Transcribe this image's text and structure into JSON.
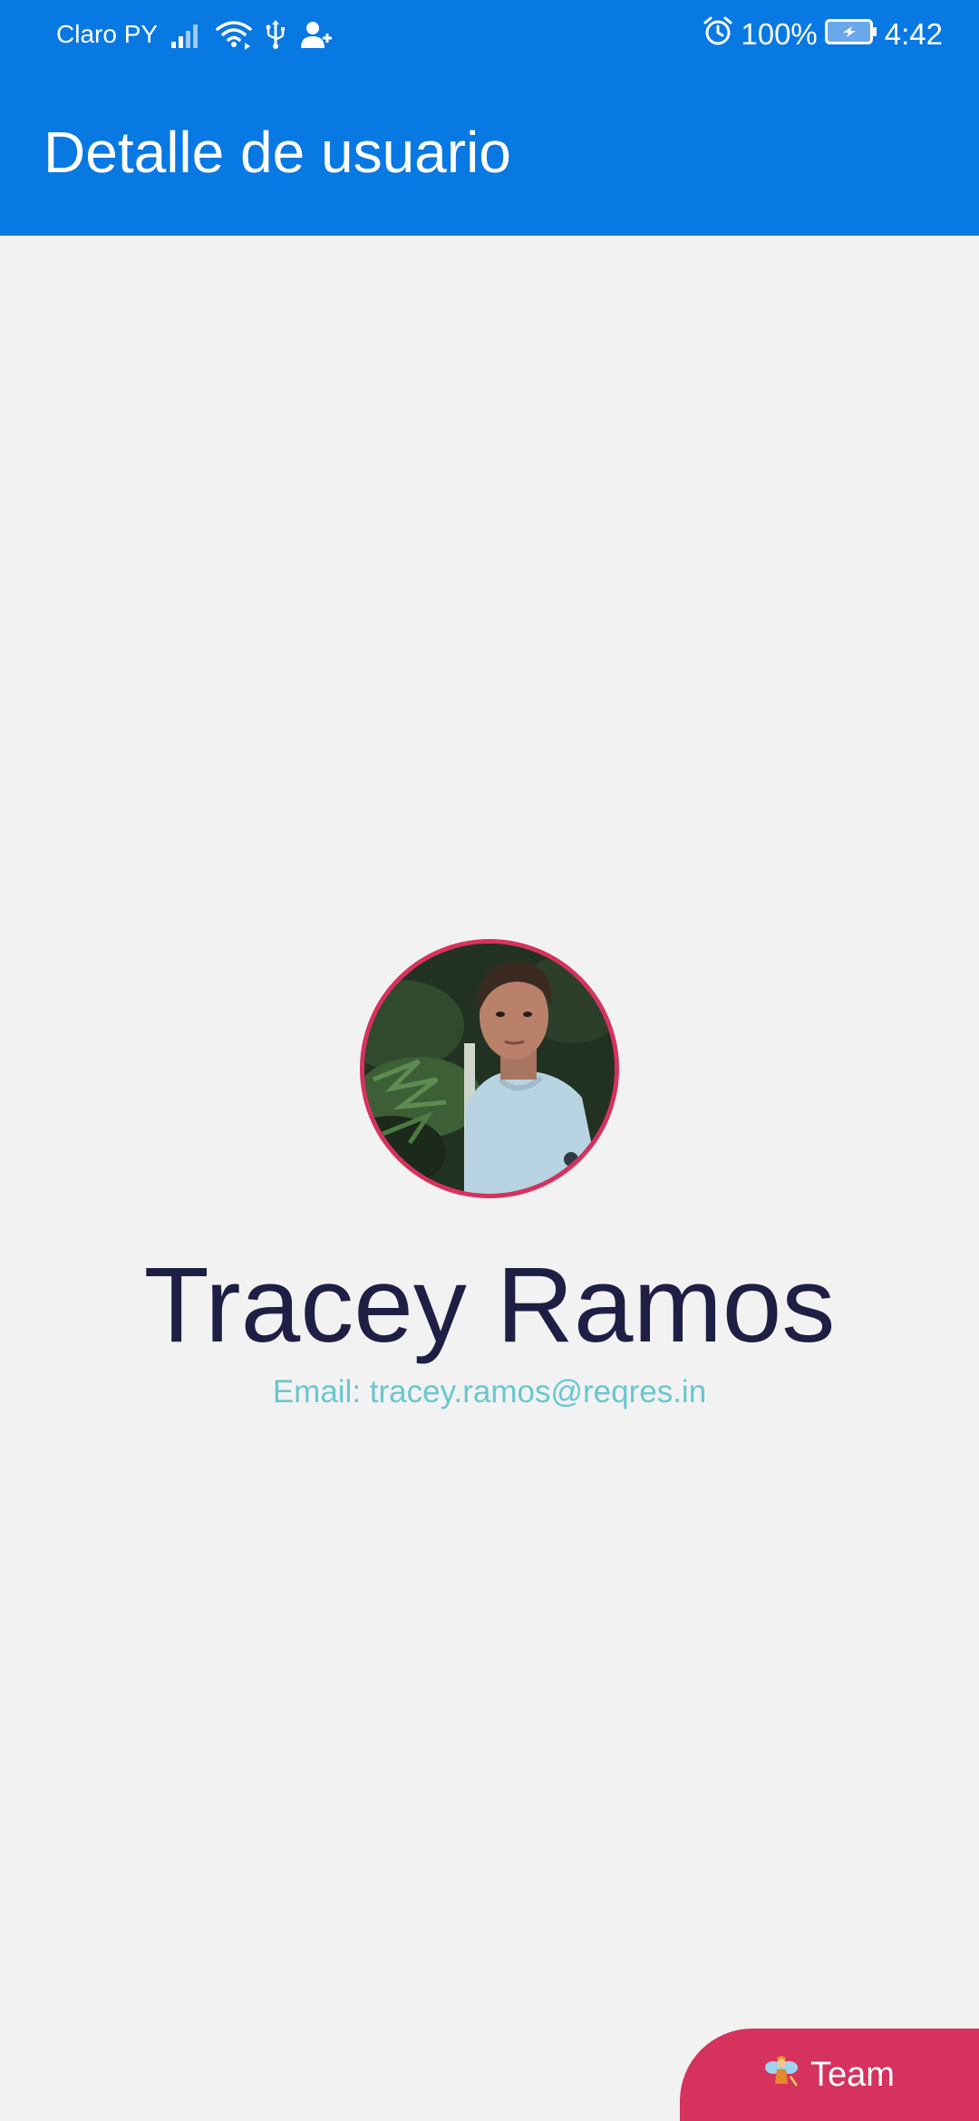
{
  "status_bar": {
    "carrier": "Claro PY",
    "battery_percent": "100%",
    "time": "4:42",
    "icons": [
      "signal-icon",
      "wifi-icon",
      "usb-icon",
      "user-add-icon",
      "alarm-icon",
      "battery-charging-icon"
    ]
  },
  "app_bar": {
    "title": "Detalle de usuario"
  },
  "colors": {
    "primary": "#0878e2",
    "accent": "#d6325e",
    "background": "#f2f2f2",
    "name_text": "#1f1f45",
    "email_text": "#69c7cf"
  },
  "user": {
    "name": "Tracey Ramos",
    "email_line": "Email: tracey.ramos@reqres.in"
  },
  "team_button": {
    "label": "Team",
    "icon": "fairy-icon"
  }
}
